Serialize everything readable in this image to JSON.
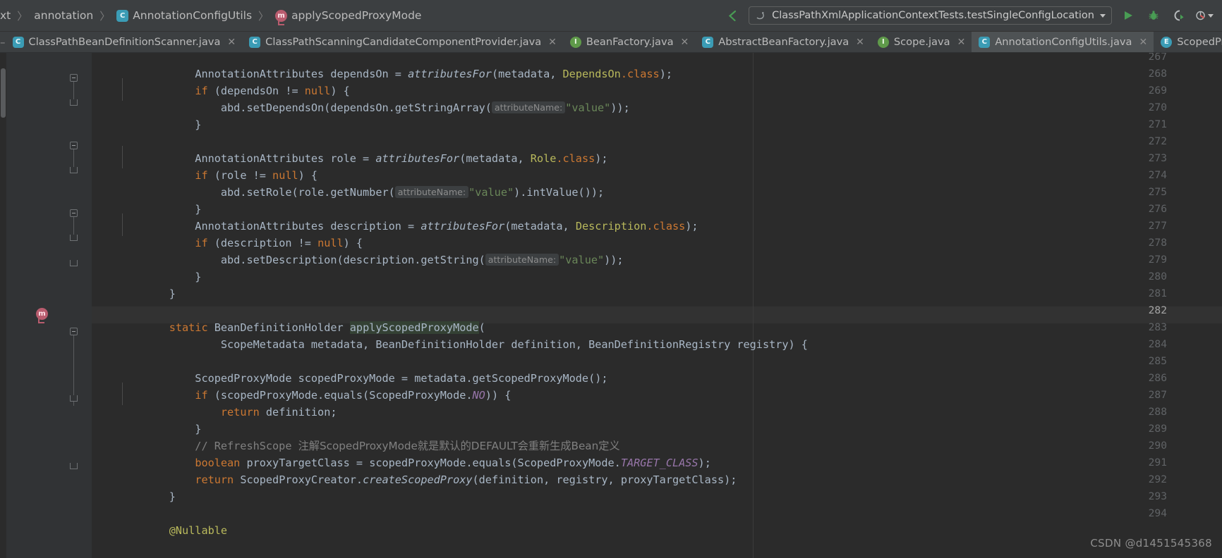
{
  "window": {
    "background_color": "#2b2b2b",
    "chrome_color": "#3c3f41"
  },
  "breadcrumb": {
    "items": [
      {
        "label": "xt",
        "icon": ""
      },
      {
        "label": "annotation",
        "icon": ""
      },
      {
        "label": "AnnotationConfigUtils",
        "icon": "class-icon"
      },
      {
        "label": "applyScopedProxyMode",
        "icon": "method-icon"
      }
    ],
    "separator": "〉"
  },
  "toolbar": {
    "back_arrow_icon": "back-arrow-icon",
    "run_configuration": "ClassPathXmlApplicationContextTests.testSingleConfigLocation",
    "run_config_icon": "spring-icon",
    "dropdown_caret": "▾",
    "run_label": "Run",
    "debug_label": "Debug",
    "coverage_label": "Run with Coverage",
    "profiler_label": "Profiler"
  },
  "tabs": [
    {
      "label": "ClassPathBeanDefinitionScanner.java",
      "icon": "java-class-icon",
      "icon_letter": "C",
      "icon_kind": "class",
      "active": false,
      "closable": true
    },
    {
      "label": "ClassPathScanningCandidateComponentProvider.java",
      "icon": "java-class-icon",
      "icon_letter": "C",
      "icon_kind": "class",
      "active": false,
      "closable": true
    },
    {
      "label": "BeanFactory.java",
      "icon": "java-interface-icon",
      "icon_letter": "I",
      "icon_kind": "interface",
      "active": false,
      "closable": true
    },
    {
      "label": "AbstractBeanFactory.java",
      "icon": "java-class-icon",
      "icon_letter": "C",
      "icon_kind": "class",
      "active": false,
      "closable": true
    },
    {
      "label": "Scope.java",
      "icon": "java-interface-icon",
      "icon_letter": "I",
      "icon_kind": "interface",
      "active": false,
      "closable": true
    },
    {
      "label": "AnnotationConfigUtils.java",
      "icon": "java-class-icon",
      "icon_letter": "C",
      "icon_kind": "class",
      "active": true,
      "closable": true
    },
    {
      "label": "ScopedPr",
      "icon": "java-enum-icon",
      "icon_letter": "E",
      "icon_kind": "enum",
      "active": false,
      "closable": false
    }
  ],
  "editor": {
    "first_visible_line": 267,
    "highlighted_line": 282,
    "caret_line": 282,
    "caret_column_token": "applyScopedProxyMode",
    "gutter_marker_line": 282,
    "gutter_marker_icon": "overriding-method-icon",
    "lines": [
      {
        "num": 267,
        "text": "        AnnotationAttributes dependsOn = attributesFor(metadata, DependsOn.class);"
      },
      {
        "num": 268,
        "text": "        if (dependsOn != null) {"
      },
      {
        "num": 269,
        "text": "            abd.setDependsOn(dependsOn.getStringArray( attributeName: \"value\"));"
      },
      {
        "num": 270,
        "text": "        }"
      },
      {
        "num": 271,
        "text": ""
      },
      {
        "num": 272,
        "text": "        AnnotationAttributes role = attributesFor(metadata, Role.class);"
      },
      {
        "num": 273,
        "text": "        if (role != null) {"
      },
      {
        "num": 274,
        "text": "            abd.setRole(role.getNumber( attributeName: \"value\").intValue());"
      },
      {
        "num": 275,
        "text": "        }"
      },
      {
        "num": 276,
        "text": "        AnnotationAttributes description = attributesFor(metadata, Description.class);"
      },
      {
        "num": 277,
        "text": "        if (description != null) {"
      },
      {
        "num": 278,
        "text": "            abd.setDescription(description.getString( attributeName: \"value\"));"
      },
      {
        "num": 279,
        "text": "        }"
      },
      {
        "num": 280,
        "text": "    }"
      },
      {
        "num": 281,
        "text": ""
      },
      {
        "num": 282,
        "text": "    static BeanDefinitionHolder applyScopedProxyMode("
      },
      {
        "num": 283,
        "text": "            ScopeMetadata metadata, BeanDefinitionHolder definition, BeanDefinitionRegistry registry) {"
      },
      {
        "num": 284,
        "text": ""
      },
      {
        "num": 285,
        "text": "        ScopedProxyMode scopedProxyMode = metadata.getScopedProxyMode();"
      },
      {
        "num": 286,
        "text": "        if (scopedProxyMode.equals(ScopedProxyMode.NO)) {"
      },
      {
        "num": 287,
        "text": "            return definition;"
      },
      {
        "num": 288,
        "text": "        }"
      },
      {
        "num": 289,
        "text": "        // RefreshScope 注解ScopedProxyMode就是默认的DEFAULT会重新生成Bean定义"
      },
      {
        "num": 290,
        "text": "        boolean proxyTargetClass = scopedProxyMode.equals(ScopedProxyMode.TARGET_CLASS);"
      },
      {
        "num": 291,
        "text": "        return ScopedProxyCreator.createScopedProxy(definition, registry, proxyTargetClass);"
      },
      {
        "num": 292,
        "text": "    }"
      },
      {
        "num": 293,
        "text": ""
      },
      {
        "num": 294,
        "text": "    @Nullable"
      }
    ],
    "parameter_hints": {
      "attribute_name": "attributeName:"
    }
  },
  "watermark": "CSDN @d1451545368",
  "colors": {
    "keyword": "#cc7832",
    "string": "#6a8759",
    "comment": "#808080",
    "static_field": "#9876aa",
    "class_ref": "#b9b95c",
    "default_text": "#a9b7c6",
    "line_number": "#606366",
    "editor_bg": "#2b2b2b",
    "gutter_bg": "#313335",
    "caret_row_bg": "#323232",
    "identifier_highlight_bg": "#344134",
    "accent_green": "#499c54",
    "breakpoint_pink": "#b85c6e"
  }
}
